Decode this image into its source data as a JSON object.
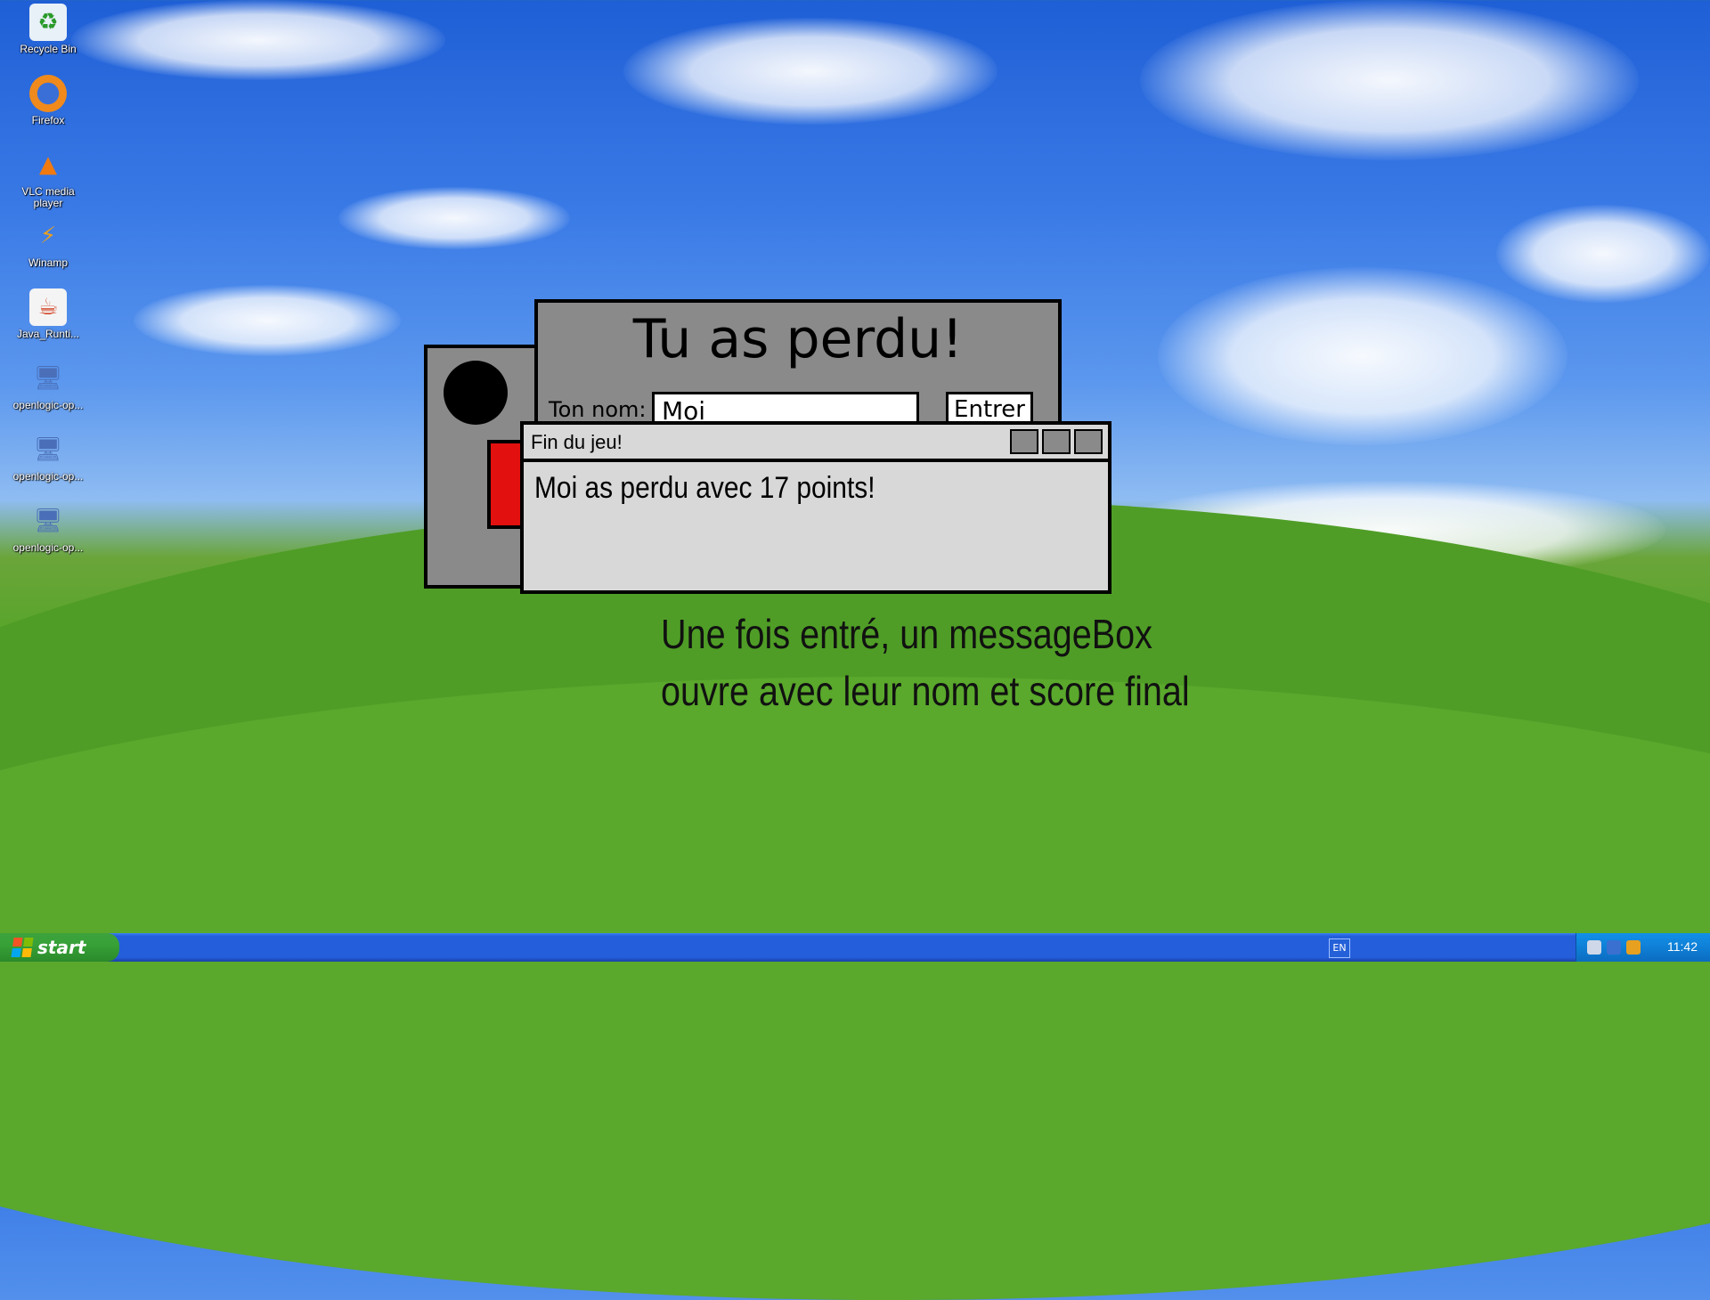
{
  "desktop": {
    "icons": [
      {
        "label": "Recycle Bin",
        "icon": "recycle-bin-icon"
      },
      {
        "label": "Firefox",
        "icon": "firefox-icon"
      },
      {
        "label": "VLC media player",
        "icon": "vlc-icon"
      },
      {
        "label": "Winamp",
        "icon": "winamp-icon"
      },
      {
        "label": "Java_Runti...",
        "icon": "java-icon"
      },
      {
        "label": "openlogic-op...",
        "icon": "installer-icon"
      },
      {
        "label": "openlogic-op...",
        "icon": "installer-icon"
      },
      {
        "label": "openlogic-op...",
        "icon": "installer-icon"
      }
    ]
  },
  "game_over_window": {
    "title": "Tu as perdu!",
    "name_label": "Ton nom:",
    "name_value": "Moi",
    "enter_label": "Entrer"
  },
  "message_box": {
    "title": "Fin du jeu!",
    "message": "Moi as perdu avec 17 points!"
  },
  "caption": {
    "line1": "Une fois entré, un messageBox",
    "line2": "ouvre avec leur nom et score final"
  },
  "taskbar": {
    "start_label": "start",
    "language": "EN",
    "clock": "11:42"
  },
  "colors": {
    "window_gray": "#8a8a8a",
    "msgbox_gray": "#d8d8d8",
    "red_block": "#e31010",
    "taskbar_blue": "#245edb",
    "start_green": "#37a137"
  }
}
